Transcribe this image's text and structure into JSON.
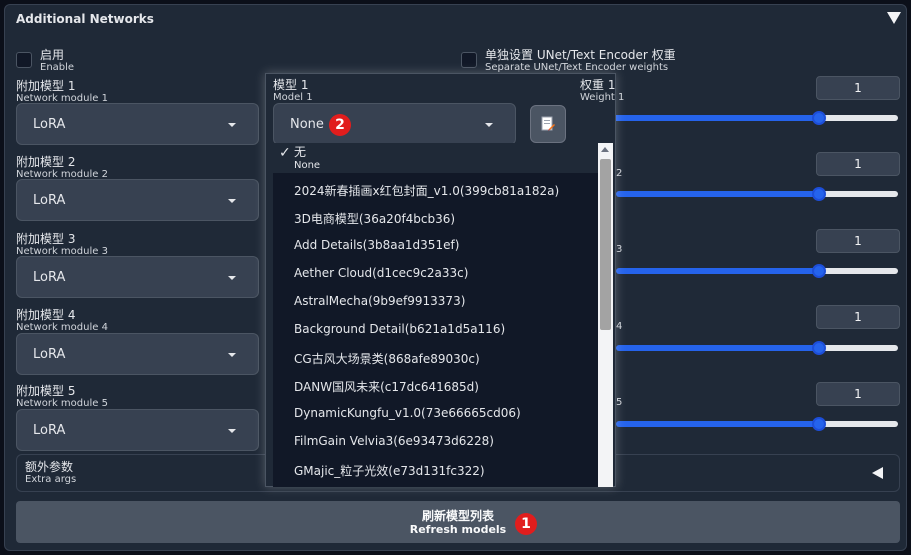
{
  "header": {
    "title": "Additional Networks"
  },
  "enable": {
    "zh": "启用",
    "en": "Enable"
  },
  "separate": {
    "zh": "单独设置 UNet/Text Encoder 权重",
    "en": "Separate UNet/Text Encoder weights"
  },
  "modules": [
    {
      "label_zh": "附加模型 1",
      "label_en": "Network module 1",
      "value": "LoRA",
      "weight": "1",
      "weight_fraction": 0.75
    },
    {
      "label_zh": "附加模型 2",
      "label_en": "Network module 2",
      "value": "LoRA",
      "weight": "1",
      "weight_fraction": 0.75
    },
    {
      "label_zh": "附加模型 3",
      "label_en": "Network module 3",
      "value": "LoRA",
      "weight": "1",
      "weight_fraction": 0.75
    },
    {
      "label_zh": "附加模型 4",
      "label_en": "Network module 4",
      "value": "LoRA",
      "weight": "1",
      "weight_fraction": 0.75
    },
    {
      "label_zh": "附加模型 5",
      "label_en": "Network module 5",
      "value": "LoRA",
      "weight": "1",
      "weight_fraction": 0.75
    }
  ],
  "weight_suffixes": [
    "2",
    "3",
    "4",
    "5"
  ],
  "model1": {
    "label_zh": "模型 1",
    "label_en": "Model 1",
    "value": "None"
  },
  "weight1": {
    "label_zh": "权重 1",
    "label_en": "Weight 1"
  },
  "dropdown_list": {
    "selected": {
      "check": "✓",
      "zh": "无",
      "en": "None"
    },
    "items": [
      "2024新春插画x红包封面_v1.0(399cb81a182a)",
      "3D电商模型(36a20f4bcb36)",
      "Add Details(3b8aa1d351ef)",
      "Aether Cloud(d1cec9c2a33c)",
      "AstralMecha(9b9ef9913373)",
      "Background Detail(b621a1d5a116)",
      "CG古风大场景类(868afe89030c)",
      "DANW国风未来(c17dc641685d)",
      "DynamicKungfu_v1.0(73e66665cd06)",
      "FilmGain Velvia3(6e93473d6228)",
      "GMajic_粒子光效(e73d131fc322)"
    ]
  },
  "extra_args": {
    "zh": "额外参数",
    "en": "Extra args"
  },
  "refresh": {
    "zh": "刷新模型列表",
    "en": "Refresh models"
  },
  "badges": {
    "refresh": "1",
    "model": "2"
  },
  "colors": {
    "accent": "#2563eb",
    "badge": "#e11d1d"
  },
  "icons": {
    "collapse": "triangle-down",
    "extra_toggle": "triangle-left",
    "tool": "edit-document-icon"
  }
}
